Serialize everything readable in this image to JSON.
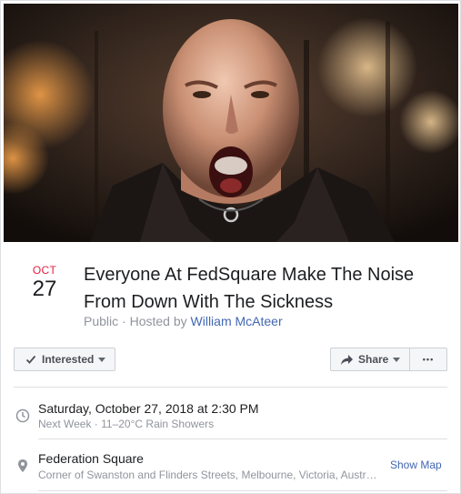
{
  "event": {
    "month": "OCT",
    "day": "27",
    "title": "Everyone At FedSquare Make The Noise From Down With The Sickness",
    "visibility": "Public",
    "hosted_by_prefix": "· Hosted by",
    "host": "William McAteer"
  },
  "actions": {
    "interested_label": "Interested",
    "share_label": "Share",
    "more_label": "•••"
  },
  "details": {
    "datetime": "Saturday, October 27, 2018 at 2:30 PM",
    "datetime_sub": "Next Week · 11–20°C Rain Showers",
    "location_name": "Federation Square",
    "location_address": "Corner of Swanston and Flinders Streets, Melbourne, Victoria, Austr…",
    "show_map_label": "Show Map"
  },
  "colors": {
    "month_red": "#e41e3f",
    "link_blue": "#4267b2",
    "muted_gray": "#90949c"
  }
}
